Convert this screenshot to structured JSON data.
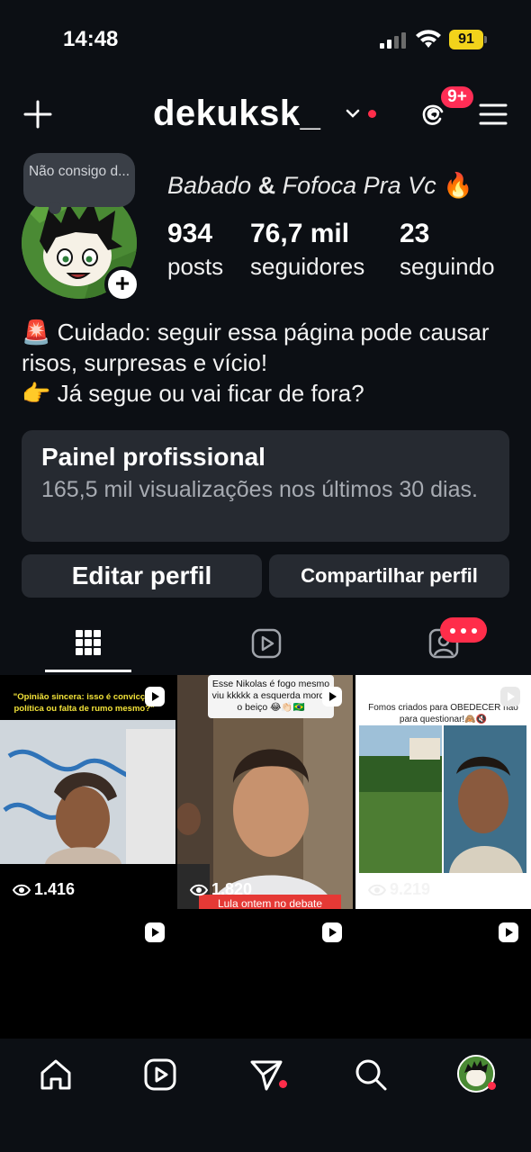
{
  "status_bar": {
    "time": "14:48",
    "battery": "91"
  },
  "header": {
    "username": "dekuksk_",
    "notification_badge": "9+"
  },
  "profile": {
    "note": "Não consigo d...",
    "display_name_part1": "Babado",
    "display_name_amp": "&",
    "display_name_part2": "Fofoca Pra Vc",
    "display_name_emoji": "🔥",
    "stats": [
      {
        "value": "934",
        "label": "posts"
      },
      {
        "value": "76,7 mil",
        "label": "seguidores"
      },
      {
        "value": "23",
        "label": "seguindo"
      }
    ],
    "bio_line1_emoji": "🚨",
    "bio_line1": "Cuidado: seguir essa página pode causar risos, surpresas e vício!",
    "bio_line2_emoji": "👉",
    "bio_line2": "Já segue ou vai ficar de fora?"
  },
  "dashboard": {
    "title": "Painel profissional",
    "subtitle": "165,5 mil visualizações nos últimos 30 dias."
  },
  "buttons": {
    "edit": "Editar perfil",
    "share": "Compartilhar perfil"
  },
  "grid": {
    "posts": [
      {
        "caption": "\"Opinião sincera: isso é convicção política ou falta de rumo mesmo?\"",
        "views": "1.416"
      },
      {
        "caption": "Esse Nikolas é fogo mesmo viu kkkkk a esquerda morde o beiço 😂👏🏻🇧🇷",
        "views": "1.820",
        "subcaption": "Lula ontem no debate"
      },
      {
        "caption": "Fomos criados para OBEDECER não para questionar!🙈🔇",
        "views": "9.219"
      }
    ]
  },
  "colors": {
    "background": "#0c0f14",
    "card": "#262a31",
    "badge_red": "#ff2d4a",
    "battery_yellow": "#f2d31b"
  },
  "icons": [
    "plus-icon",
    "chevron-down-icon",
    "threads-icon",
    "menu-icon",
    "grid-icon",
    "reels-icon",
    "tagged-icon",
    "eye-icon",
    "home-icon",
    "reels-nav-icon",
    "direct-icon",
    "search-icon"
  ]
}
